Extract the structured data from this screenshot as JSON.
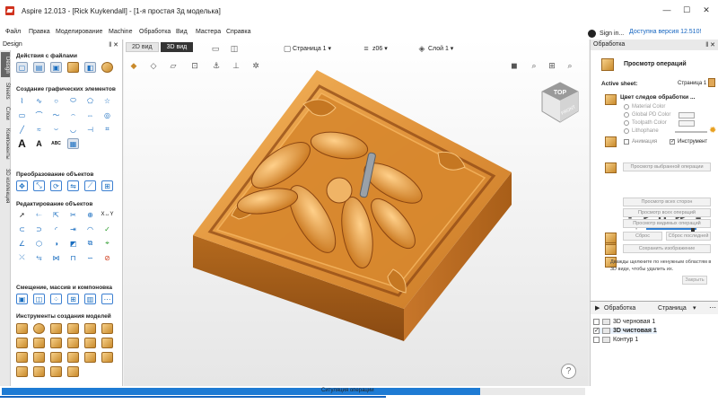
{
  "window": {
    "title": "Aspire 12.013 - [Rick Kuykendall] - [1-я простая 3д моделька]",
    "min": "—",
    "max": "☐",
    "close": "✕"
  },
  "menu": {
    "items": [
      "Файл",
      "Правка",
      "Моделирование",
      "Machine",
      "Обработка",
      "Вид",
      "Мастера",
      "Справка"
    ],
    "sign_in": "Sign in...",
    "version_link": "Доступна версия 12.510!"
  },
  "left_panel": {
    "title": "Design",
    "controls": "‖ ✕",
    "vertical_tabs": [
      "Design",
      "Sheets",
      "Слои",
      "Компоненты",
      "3D коллекция"
    ],
    "sections": [
      {
        "title": "Действия с файлами"
      },
      {
        "title": "Создание графических элементов"
      },
      {
        "title": "Преобразование объектов"
      },
      {
        "title": "Редактирование объектов"
      },
      {
        "title": "Смещение, массив и компоновка"
      },
      {
        "title": "Инструменты создания моделей"
      }
    ],
    "glyph_text": {
      "letter_a": "A",
      "abc": "ABC"
    }
  },
  "viewport": {
    "tabs": [
      "2D вид",
      "3D вид"
    ],
    "active_tab": "3D вид",
    "page_selector": "Страница 1 ▾",
    "z_selector": "z06 ▾",
    "layer_selector": "Слой 1 ▾",
    "cube_top": "TOP",
    "cube_front": "FRONT",
    "help": "?"
  },
  "right_panel": {
    "title": "Обработка",
    "controls": "‖ ✕",
    "op_title": "Просмотр операций",
    "active_sheet_label": "Active sheet:",
    "active_sheet_value": "Страница 1",
    "color_label": "Цвет следов обработки ...",
    "color_options": [
      "Material Color",
      "Global PD Color",
      "Toolpath Color",
      "Lithophane"
    ],
    "animation_label": "Анимация",
    "tool_label": "Инструмент",
    "buttons": {
      "preview_selected": "Просмотр выбранной операции",
      "preview_visible": "Просмотр всех сторон",
      "preview_all": "Просмотр всех операций",
      "preview_visible_ops": "Просмотр видимых операций",
      "reset": "Сброс",
      "reset_last": "Сброс последней",
      "save_image": "Сохранить изображение",
      "close": "Закрыть"
    },
    "speed_label": "Скорос",
    "play_glyphs": [
      "■",
      "▶",
      "❚❚",
      "▶▶",
      "⏏"
    ],
    "note": "Дважды щелкните по ненужным областям в 3D виде, чтобы удалить их.",
    "speed_value": 0.92
  },
  "toolpaths_panel": {
    "title": "Обработка",
    "page_selector": "Страница",
    "items": [
      {
        "label": "3D черновая 1",
        "checked": false
      },
      {
        "label": "3D чистовая 1",
        "checked": true
      },
      {
        "label": "Контур 1",
        "checked": false
      }
    ]
  },
  "status": {
    "text": "Ситуляция операции",
    "progress": 0.82
  },
  "colors": {
    "accent": "#1e7bd4",
    "wood_light": "#f0a848",
    "wood_dark": "#8a4512",
    "viewport_bg": "#eeeeee"
  }
}
